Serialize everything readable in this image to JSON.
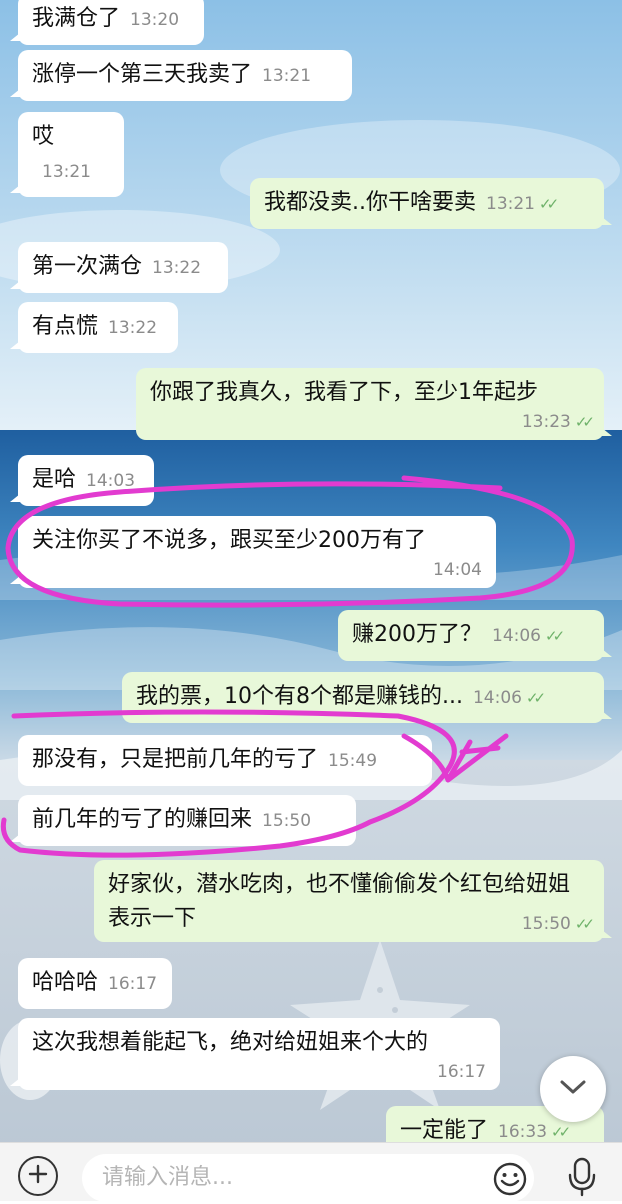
{
  "messages": [
    {
      "id": "m1",
      "side": "in",
      "text": "我满仓了",
      "time": "13:20"
    },
    {
      "id": "m2",
      "side": "in",
      "text": "涨停一个第三天我卖了",
      "time": "13:21"
    },
    {
      "id": "m3",
      "side": "in",
      "text": "哎",
      "time": "13:21"
    },
    {
      "id": "m4",
      "side": "out",
      "text": "我都没卖..你干啥要卖",
      "time": "13:21",
      "status": "read"
    },
    {
      "id": "m5",
      "side": "in",
      "text": "第一次满仓",
      "time": "13:22"
    },
    {
      "id": "m6",
      "side": "in",
      "text": "有点慌",
      "time": "13:22"
    },
    {
      "id": "m7",
      "side": "out",
      "text": "你跟了我真久，我看了下，至少1年起步",
      "time": "13:23",
      "status": "read"
    },
    {
      "id": "m8",
      "side": "in",
      "text": "是哈",
      "time": "14:03"
    },
    {
      "id": "m9",
      "side": "in",
      "text": "关注你买了不说多，跟买至少200万有了",
      "time": "14:04"
    },
    {
      "id": "m10",
      "side": "out",
      "text": "赚200万了？",
      "time": "14:06",
      "status": "read"
    },
    {
      "id": "m11",
      "side": "out",
      "text": "我的票，10个有8个都是赚钱的...",
      "time": "14:06",
      "status": "read"
    },
    {
      "id": "m12",
      "side": "in",
      "text": "那没有，只是把前几年的亏了",
      "time": "15:49"
    },
    {
      "id": "m13",
      "side": "in",
      "text": "前几年的亏了的赚回来",
      "time": "15:50"
    },
    {
      "id": "m14",
      "side": "out",
      "text": "好家伙，潜水吃肉，也不懂偷偷发个红包给妞姐表示一下",
      "time": "15:50",
      "status": "read"
    },
    {
      "id": "m15",
      "side": "in",
      "text": "哈哈哈",
      "time": "16:17"
    },
    {
      "id": "m16",
      "side": "in",
      "text": "这次我想着能起飞，绝对给妞姐来个大的",
      "time": "16:17"
    },
    {
      "id": "m17",
      "side": "out",
      "text": "一定能了",
      "time": "16:33",
      "status": "read"
    }
  ],
  "read_receipt_glyph": "✓✓",
  "input": {
    "placeholder": "请输入消息..."
  },
  "icons": {
    "attach": "plus-icon",
    "emoji": "emoji-icon",
    "voice": "microphone-icon",
    "scroll": "chevron-down-icon"
  },
  "colors": {
    "incoming_bubble": "#ffffff",
    "outgoing_bubble": "#e8f8d9",
    "read_tick": "#6fb26a",
    "annotation": "#e23bd0"
  }
}
